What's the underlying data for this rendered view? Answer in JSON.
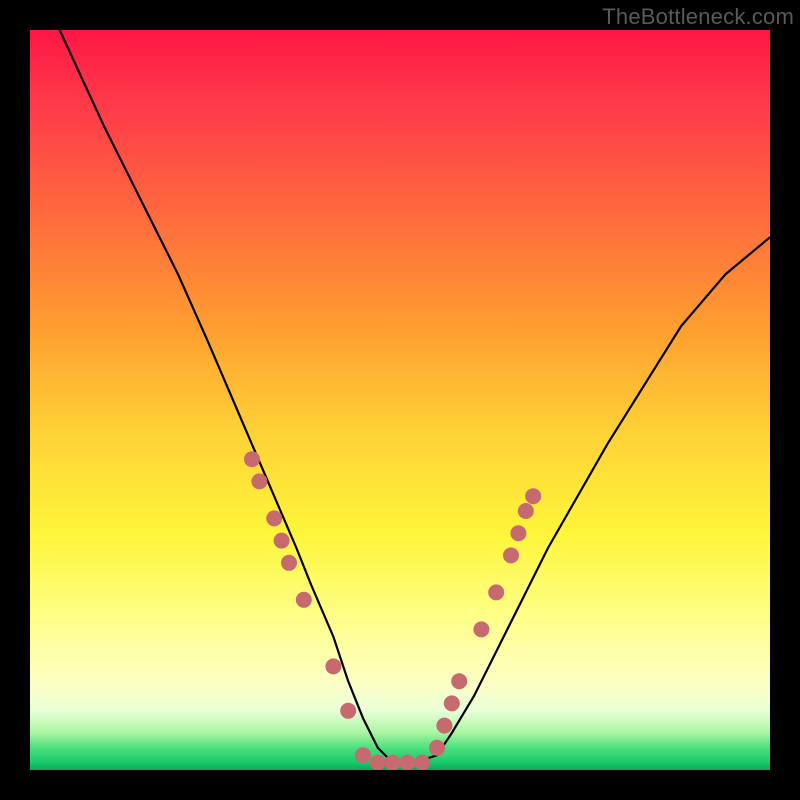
{
  "watermark": "TheBottleneck.com",
  "colors": {
    "background": "#000000",
    "curve": "#000000",
    "dots": "#c76a6f",
    "gradient_top": "#ff1744",
    "gradient_bottom": "#0aa85e"
  },
  "chart_data": {
    "type": "line",
    "title": "",
    "xlabel": "",
    "ylabel": "",
    "xlim": [
      0,
      100
    ],
    "ylim": [
      0,
      100
    ],
    "grid": false,
    "legend": false,
    "series": [
      {
        "name": "bottleneck-curve",
        "x": [
          4,
          10,
          15,
          20,
          24,
          27,
          30,
          33,
          36,
          38,
          41,
          43,
          45,
          47,
          49,
          52,
          55,
          57,
          60,
          63,
          66,
          70,
          74,
          78,
          83,
          88,
          94,
          100
        ],
        "y": [
          100,
          87,
          77,
          67,
          58,
          51,
          44,
          37,
          30,
          25,
          18,
          12,
          7,
          3,
          1,
          1,
          2,
          5,
          10,
          16,
          22,
          30,
          37,
          44,
          52,
          60,
          67,
          72
        ]
      }
    ],
    "scatter_points": {
      "name": "highlight-dots",
      "points": [
        {
          "x": 30,
          "y": 42
        },
        {
          "x": 31,
          "y": 39
        },
        {
          "x": 33,
          "y": 34
        },
        {
          "x": 34,
          "y": 31
        },
        {
          "x": 35,
          "y": 28
        },
        {
          "x": 37,
          "y": 23
        },
        {
          "x": 41,
          "y": 14
        },
        {
          "x": 43,
          "y": 8
        },
        {
          "x": 45,
          "y": 2
        },
        {
          "x": 47,
          "y": 1
        },
        {
          "x": 49,
          "y": 1
        },
        {
          "x": 51,
          "y": 1
        },
        {
          "x": 53,
          "y": 1
        },
        {
          "x": 55,
          "y": 3
        },
        {
          "x": 56,
          "y": 6
        },
        {
          "x": 57,
          "y": 9
        },
        {
          "x": 58,
          "y": 12
        },
        {
          "x": 61,
          "y": 19
        },
        {
          "x": 63,
          "y": 24
        },
        {
          "x": 65,
          "y": 29
        },
        {
          "x": 66,
          "y": 32
        },
        {
          "x": 67,
          "y": 35
        },
        {
          "x": 68,
          "y": 37
        }
      ],
      "radius": 8
    }
  }
}
